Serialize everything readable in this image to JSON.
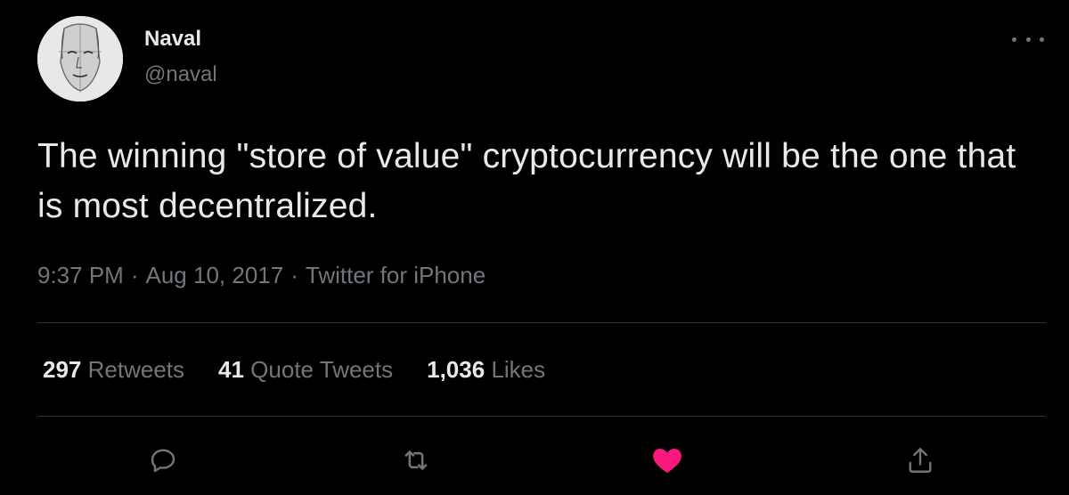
{
  "user": {
    "display_name": "Naval",
    "handle": "@naval"
  },
  "tweet": {
    "text": "The winning \"store of value\" cryptocurrency will be the one that is most decentralized.",
    "time": "9:37 PM",
    "separator": "·",
    "date": "Aug 10, 2017",
    "source": "Twitter for iPhone"
  },
  "stats": {
    "retweets_count": "297",
    "retweets_label": "Retweets",
    "quote_tweets_count": "41",
    "quote_tweets_label": "Quote Tweets",
    "likes_count": "1,036",
    "likes_label": "Likes"
  },
  "actions": {
    "reply_icon": "reply-icon",
    "retweet_icon": "retweet-icon",
    "like_icon": "heart-icon",
    "like_active": true,
    "share_icon": "share-icon"
  },
  "colors": {
    "background": "#000000",
    "primary_text": "#e7e9ea",
    "secondary_text": "#71767b",
    "divider": "#2f3336",
    "like": "#f91880"
  }
}
